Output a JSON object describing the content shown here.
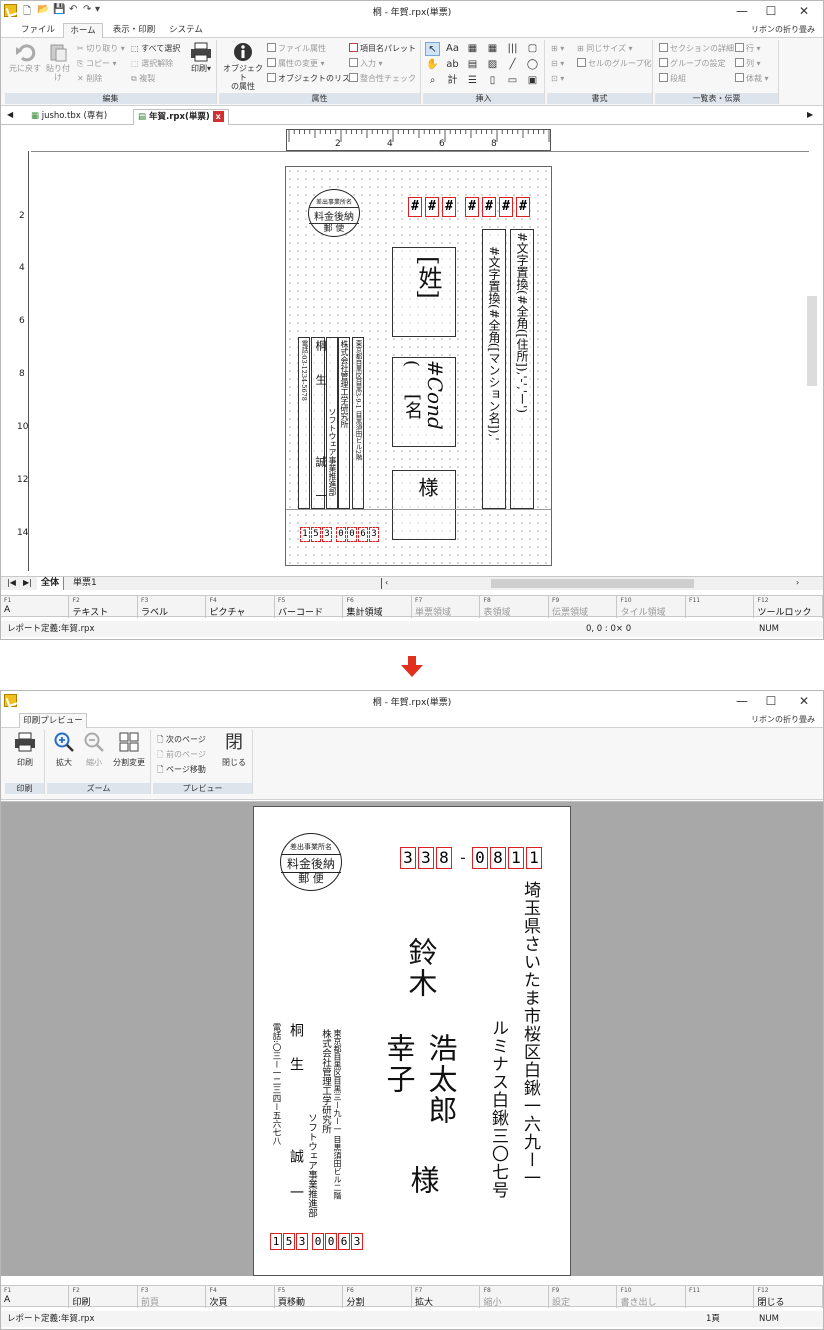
{
  "top": {
    "title": "桐 - 年賀.rpx(単票)",
    "ribbon_fold": "リボンの折り畳み",
    "tabs": [
      "ファイル",
      "ホーム",
      "表示・印刷",
      "システム"
    ],
    "groups": {
      "edit": "編集",
      "attr": "属性",
      "insert": "挿入",
      "format": "書式",
      "list": "一覧表・伝票"
    },
    "buttons": {
      "undo": "元に戻す",
      "paste": "貼り付け",
      "cut": "切り取り",
      "copy": "コピー",
      "delete": "削除",
      "select_all": "すべて選択",
      "deselect": "選択解除",
      "duplicate": "複製",
      "print": "印刷",
      "obj_attr_1": "オブジェクト",
      "obj_attr_2": "の属性",
      "file_attr": "ファイル属性",
      "attr_change": "属性の変更",
      "obj_list": "オブジェクトのリスト",
      "item_palette": "項目名パレット",
      "input": "入力",
      "consistency": "整合性チェック",
      "same_size": "同じサイズ",
      "cell_group": "セルのグループ化",
      "section_detail": "セクションの詳細",
      "group_setting": "グループの設定",
      "columns": "段組",
      "row": "行",
      "col": "列",
      "style": "体裁"
    },
    "doc_tabs": [
      "jusho.tbx (専有)",
      "年賀.rpx(単票)"
    ],
    "ruler_h": [
      "2",
      "4",
      "6",
      "8"
    ],
    "ruler_v": [
      "2",
      "4",
      "6",
      "8",
      "10",
      "12",
      "14"
    ],
    "sheet_tabs": [
      "全体",
      "単票1"
    ],
    "fkeys": [
      {
        "n": "F1",
        "l": "A"
      },
      {
        "n": "F2",
        "l": "テキスト"
      },
      {
        "n": "F3",
        "l": "ラベル"
      },
      {
        "n": "F4",
        "l": "ピクチャ"
      },
      {
        "n": "F5",
        "l": "バーコード"
      },
      {
        "n": "F6",
        "l": "集計領域"
      },
      {
        "n": "F7",
        "l": "単票領域"
      },
      {
        "n": "F8",
        "l": "表領域"
      },
      {
        "n": "F9",
        "l": "伝票領域"
      },
      {
        "n": "F10",
        "l": "タイル領域"
      },
      {
        "n": "F11",
        "l": ""
      },
      {
        "n": "F12",
        "l": "ツールロック"
      }
    ],
    "status_left": "レポート定義:年賀.rpx",
    "status_coords": "0, 0 : 0× 0",
    "status_num": "NUM",
    "design": {
      "zip_boxes": [
        "#",
        "#",
        "#",
        "#",
        "#",
        "#",
        "#"
      ],
      "stamp_l1": "差出事業所名",
      "stamp_l2": "料金後納",
      "stamp_l3": "郵 便",
      "sei": "[姓]",
      "cond": "#Cond",
      "paren": "(",
      "mei": "[名",
      "sama": "様",
      "addr1": "#文字置換(#全角([住所]),'-','ー')",
      "addr2": "#文字置換(#全角([マンション名]),'",
      "sender_addr": "東京都目黒区目黒3-9-1 目黒須田ビル2階",
      "sender_co": "株式会社管理工学研究所",
      "sender_dept": "ソフトウェア事業推進部",
      "sender_name1": "桐",
      "sender_name2": "生",
      "sender_name3": "誠",
      "sender_name4": "一",
      "sender_tel": "電話:03-1234-5678",
      "sender_zip": [
        "1",
        "5",
        "3",
        "0",
        "0",
        "6",
        "3"
      ]
    }
  },
  "bottom": {
    "title": "桐 - 年賀.rpx(単票)",
    "ribbon_fold": "リボンの折り畳み",
    "tab": "印刷プレビュー",
    "groups": {
      "print": "印刷",
      "zoom": "ズーム",
      "preview": "プレビュー"
    },
    "buttons": {
      "print": "印刷",
      "zoom_in": "拡大",
      "zoom_out": "縮小",
      "split": "分割変更",
      "next_page": "次のページ",
      "prev_page": "前のページ",
      "goto_page": "ページ移動",
      "close_glyph": "閉",
      "close": "閉じる"
    },
    "fkeys": [
      {
        "n": "F1",
        "l": "A"
      },
      {
        "n": "F2",
        "l": "印刷"
      },
      {
        "n": "F3",
        "l": "前頁"
      },
      {
        "n": "F4",
        "l": "次頁"
      },
      {
        "n": "F5",
        "l": "頁移動"
      },
      {
        "n": "F6",
        "l": "分割"
      },
      {
        "n": "F7",
        "l": "拡大"
      },
      {
        "n": "F8",
        "l": "縮小"
      },
      {
        "n": "F9",
        "l": "設定"
      },
      {
        "n": "F10",
        "l": "書き出し"
      },
      {
        "n": "F11",
        "l": ""
      },
      {
        "n": "F12",
        "l": "閉じる"
      }
    ],
    "status_left": "レポート定義:年賀.rpx",
    "status_page": "1頁",
    "status_num": "NUM",
    "preview": {
      "zip": [
        "3",
        "3",
        "8",
        "-",
        "0",
        "8",
        "1",
        "1"
      ],
      "stamp_l1": "差出事業所名",
      "stamp_l2": "料金後納",
      "stamp_l3": "郵 便",
      "addr1": "埼玉県さいたま市桜区白鍬一六九ー一",
      "addr2": "ルミナス白鍬三〇七号",
      "surname": "鈴木",
      "given1": "浩太郎",
      "given2": "幸子",
      "sama": "様",
      "sender_addr": "東京都目黒区目黒三ー九ー一 目黒須田ビル二階",
      "sender_co": "株式会社管理工学研究所",
      "sender_dept": "ソフトウェア事業推進部",
      "sender_name1": "桐",
      "sender_name2": "生",
      "sender_name3": "誠",
      "sender_name4": "一",
      "sender_tel": "電話:〇三ー一二三四ー五六七八",
      "sender_zip": [
        "1",
        "5",
        "3",
        "0",
        "0",
        "6",
        "3"
      ]
    }
  },
  "colors": {
    "red": "#e02020",
    "arrow": "#e0301e",
    "group_label": "#dde4ec",
    "preview_bg": "#a8a8a8"
  }
}
